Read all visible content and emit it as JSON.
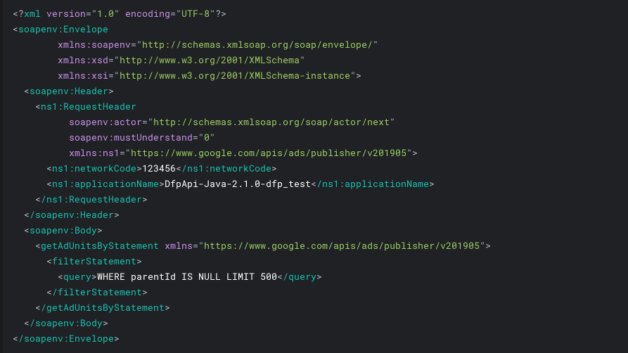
{
  "xml_decl": {
    "version": "1.0",
    "encoding": "UTF-8"
  },
  "envelope": {
    "open_tag": "soapenv:Envelope",
    "close_tag": "/soapenv:Envelope",
    "attrs": {
      "n0": "xmlns:soapenv",
      "v0": "http://schemas.xmlsoap.org/soap/envelope/",
      "n1": "xmlns:xsd",
      "v1": "http://www.w3.org/2001/XMLSchema",
      "n2": "xmlns:xsi",
      "v2": "http://www.w3.org/2001/XMLSchema-instance"
    },
    "header": {
      "open_tag": "soapenv:Header",
      "close_tag": "/soapenv:Header",
      "request_header": {
        "open_tag": "ns1:RequestHeader",
        "close_tag": "/ns1:RequestHeader",
        "attrs": {
          "n0": "soapenv:actor",
          "v0": "http://schemas.xmlsoap.org/soap/actor/next",
          "n1": "soapenv:mustUnderstand",
          "v1": "0",
          "n2": "xmlns:ns1",
          "v2": "https://www.google.com/apis/ads/publisher/v201905"
        },
        "networkCode": {
          "open_tag": "ns1:networkCode",
          "close_tag": "/ns1:networkCode",
          "text": "123456"
        },
        "applicationName": {
          "open_tag": "ns1:applicationName",
          "close_tag": "/ns1:applicationName",
          "text": "DfpApi-Java-2.1.0-dfp_test"
        }
      }
    },
    "body": {
      "open_tag": "soapenv:Body",
      "close_tag": "/soapenv:Body",
      "getAdUnits": {
        "open_tag": "getAdUnitsByStatement",
        "close_tag": "/getAdUnitsByStatement",
        "attrs": {
          "n0": "xmlns",
          "v0": "https://www.google.com/apis/ads/publisher/v201905"
        },
        "filterStatement": {
          "open_tag": "filterStatement",
          "close_tag": "/filterStatement",
          "query": {
            "open_tag": "query",
            "close_tag": "/query",
            "text": "WHERE parentId IS NULL LIMIT 500"
          }
        }
      }
    }
  },
  "kw": {
    "version": "version",
    "encoding": "encoding"
  },
  "p": {
    "lt": "<",
    "gt": ">",
    "ltq": "<?",
    "qgt": "?>",
    "eq": "=",
    "q": "\"",
    "xml": "xml "
  }
}
